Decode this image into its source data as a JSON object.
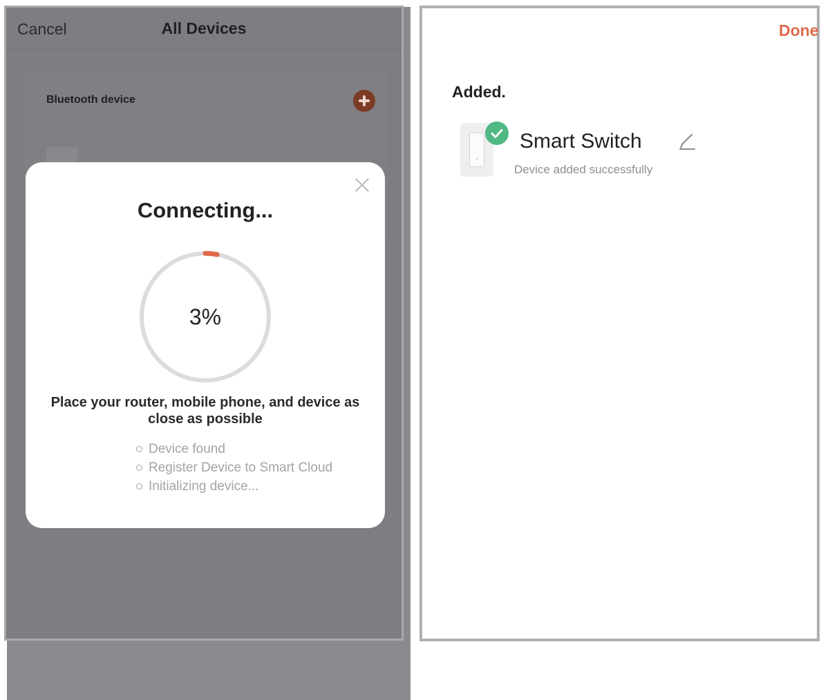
{
  "left_screen": {
    "nav": {
      "cancel_label": "Cancel",
      "title": "All Devices"
    },
    "bluetooth_card": {
      "label": "Bluetooth device"
    },
    "modal": {
      "title": "Connecting...",
      "progress_percent": 3,
      "progress_text": "3%",
      "hint": "Place your router, mobile phone, and device as close as possible",
      "steps": [
        "Device found",
        "Register Device to Smart Cloud",
        "Initializing device..."
      ]
    }
  },
  "right_screen": {
    "done_label": "Done",
    "added_title": "Added.",
    "device": {
      "name": "Smart Switch",
      "status": "Device added successfully"
    }
  },
  "colors": {
    "accent": "#e06a4b",
    "progress": "#e06a4b",
    "success": "#4fb883",
    "overlay": "#7e7d82"
  },
  "icons": {
    "add": "plus-circle-icon",
    "close": "close-icon",
    "check": "check-icon",
    "edit": "pencil-icon",
    "device": "light-switch-icon"
  }
}
